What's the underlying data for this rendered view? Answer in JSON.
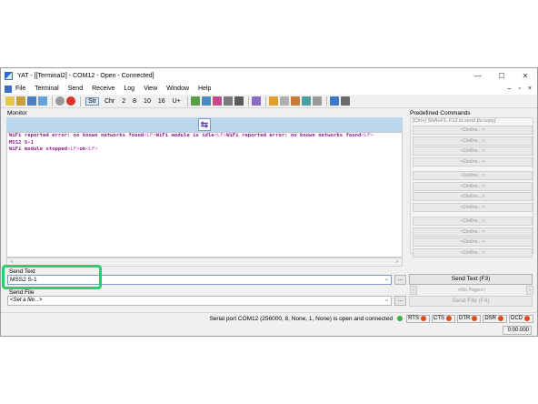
{
  "window": {
    "title": "YAT - [[Terminal2] - COM12 - Open - Connected]",
    "controls": [
      "—",
      "☐",
      "✕"
    ]
  },
  "menu": {
    "items": [
      "File",
      "Terminal",
      "Send",
      "Receive",
      "Log",
      "View",
      "Window",
      "Help"
    ],
    "mdi_controls": [
      "–",
      "▫",
      "×"
    ]
  },
  "toolbar": {
    "str_label": "Str",
    "chr_label": "Chr",
    "radix": [
      "2",
      "8",
      "10",
      "16",
      "U+"
    ]
  },
  "monitor": {
    "label": "Monitor",
    "lines": [
      [
        {
          "t": "WiFi reported error: no known networks found",
          "lf": false
        },
        {
          "t": "<LF>",
          "lf": true
        },
        {
          "t": "WiFi module is idle",
          "lf": false
        },
        {
          "t": "<LF>",
          "lf": true
        },
        {
          "t": "WiFi reported error: no known networks found",
          "lf": false
        },
        {
          "t": "<LF>",
          "lf": true
        }
      ],
      [
        {
          "t": "MSS2 S-1",
          "lf": false
        }
      ],
      [
        {
          "t": "WiFi module stopped",
          "lf": false
        },
        {
          "t": "<LF>",
          "lf": true
        },
        {
          "t": "ok",
          "lf": false
        },
        {
          "t": "<LF>",
          "lf": true
        }
      ]
    ]
  },
  "send_text": {
    "label": "Send Text",
    "value": "MSS2 S-1",
    "browse_label": "...",
    "button_label": "Send Text (F3)"
  },
  "send_file": {
    "label": "Send File",
    "placeholder": "<Set a file...>",
    "browse_label": "...",
    "button_label": "Send File (F4)"
  },
  "predefined": {
    "label": "Predefined Commands",
    "hint": "[Ctrl+] Shift+F1..F12 to send [to copy]",
    "buttons": [
      "<Define...>",
      "<Define...>",
      "<Define...>",
      "<Define...>",
      "<Define...>",
      "<Define...>",
      "<Define...>",
      "<Define...>",
      "<Define...>",
      "<Define...>",
      "<Define...>",
      "<Define...>"
    ],
    "pager_label": "<No Pages>"
  },
  "status": {
    "text": "Serial port COM12 (256000, 8, None, 1, None) is open and connected",
    "signals": [
      {
        "name": "RTS",
        "color": "#e04a1b"
      },
      {
        "name": "CTS",
        "color": "#e04a1b"
      },
      {
        "name": "DTR",
        "color": "#e04a1b"
      },
      {
        "name": "DSR",
        "color": "#e04a1b"
      },
      {
        "name": "DCD",
        "color": "#e04a1b"
      }
    ],
    "connected_color": "#3cb043",
    "time": "0:00.000"
  },
  "colors": {
    "highlight": "#2ecc71",
    "monitor_text": "#8b1a8b",
    "monitor_header": "#bcd6ee"
  }
}
